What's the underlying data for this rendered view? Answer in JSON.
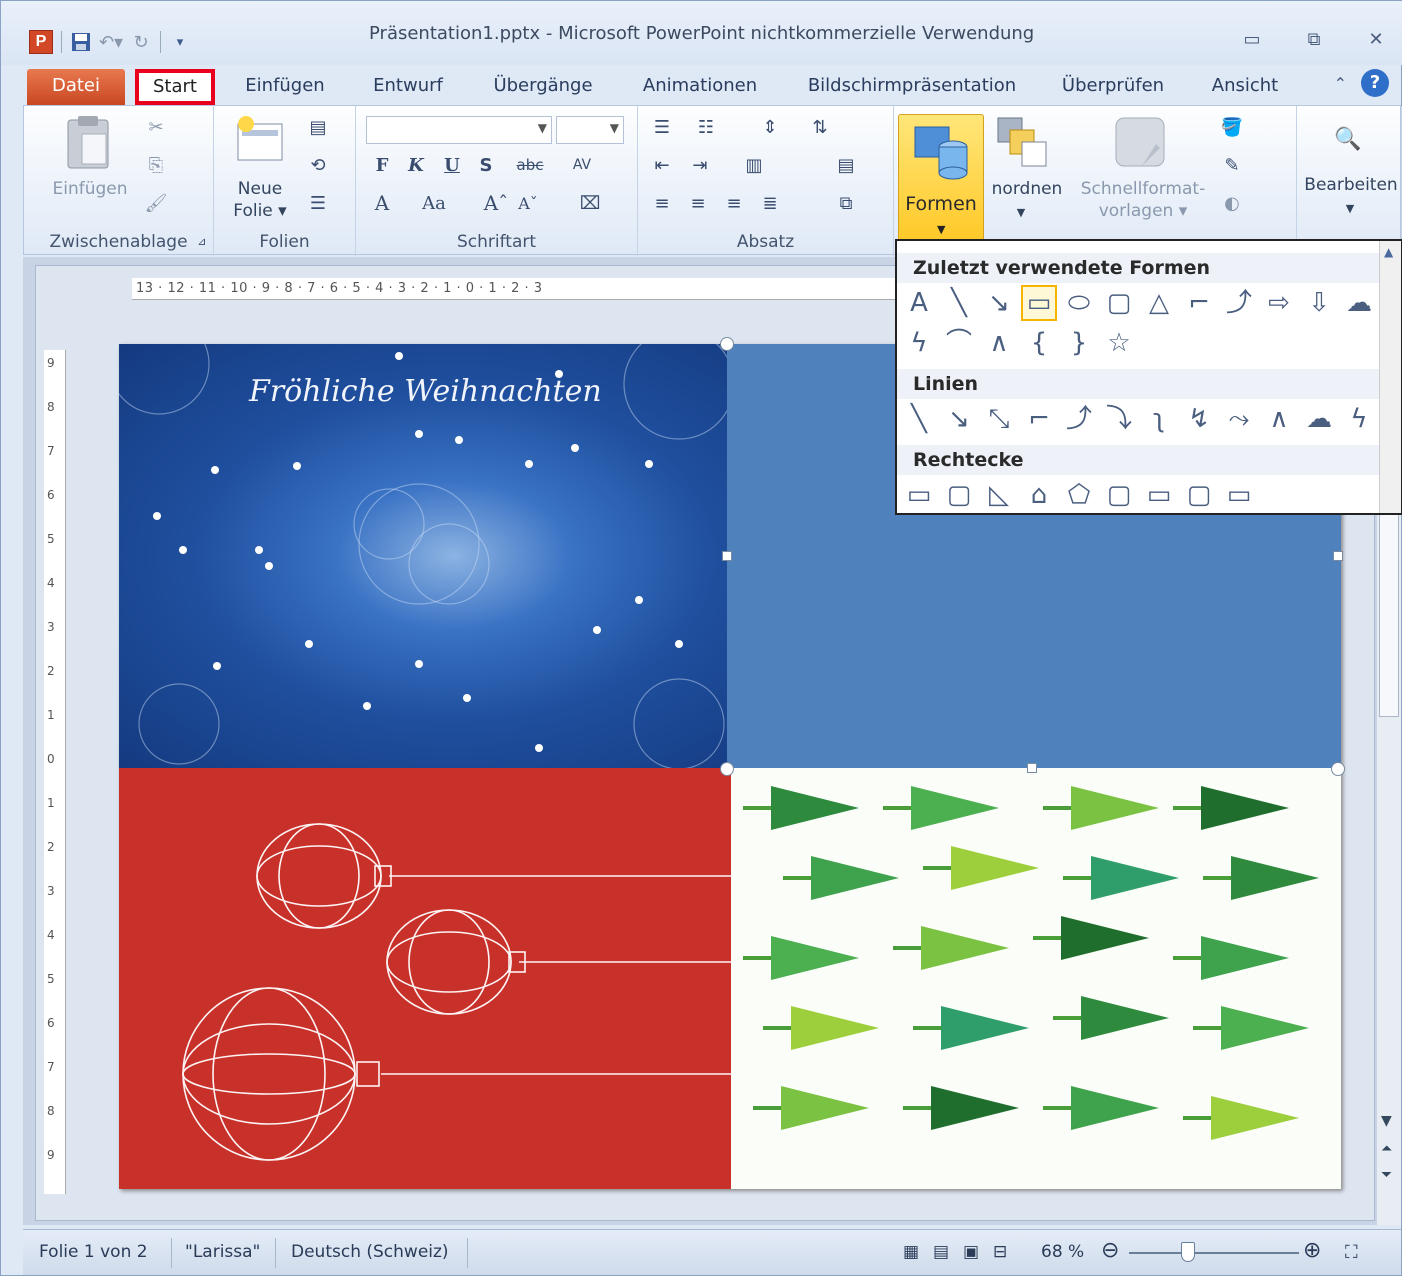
{
  "window": {
    "title": "Präsentation1.pptx - Microsoft PowerPoint nichtkommerzielle Verwendung"
  },
  "tabs": [
    {
      "label": "Datei"
    },
    {
      "label": "Start"
    },
    {
      "label": "Einfügen"
    },
    {
      "label": "Entwurf"
    },
    {
      "label": "Übergänge"
    },
    {
      "label": "Animationen"
    },
    {
      "label": "Bildschirmpräsentation"
    },
    {
      "label": "Überprüfen"
    },
    {
      "label": "Ansicht"
    }
  ],
  "ribbon": {
    "clipboard": {
      "paste_label": "Einfügen",
      "group_label": "Zwischenablage"
    },
    "slides": {
      "new_slide_label": "Neue",
      "new_slide_label2": "Folie",
      "group_label": "Folien"
    },
    "font": {
      "bold": "F",
      "italic": "K",
      "underline": "U",
      "shadow": "S",
      "strike": "abc",
      "spacing": "AV",
      "group_label": "Schriftart"
    },
    "paragraph": {
      "group_label": "Absatz"
    },
    "drawing": {
      "shapes_label": "Formen",
      "arrange_label": "nordnen",
      "quickstyles_label": "Schnellformat-",
      "quickstyles_label2": "vorlagen"
    },
    "editing": {
      "label": "Bearbeiten"
    }
  },
  "ruler": {
    "horizontal": "13 · 12 · 11 · 10 · 9 · 8 · 7 · 6 · 5 · 4 · 3 · 2 · 1 · 0 · 1 · 2 · 3",
    "vertical": [
      "9",
      "8",
      "7",
      "6",
      "5",
      "4",
      "3",
      "2",
      "1",
      "0",
      "1",
      "2",
      "3",
      "4",
      "5",
      "6",
      "7",
      "8",
      "9"
    ]
  },
  "slide": {
    "greeting": "Fröhliche Weihnachten"
  },
  "shapes_panel": {
    "recent_heading": "Zuletzt verwendete Formen",
    "lines_heading": "Linien",
    "rectangles_heading": "Rechtecke",
    "recent_row1": [
      "A",
      "╲",
      "↘",
      "▭",
      "⬭",
      "▢",
      "△",
      "⌐",
      "⤴",
      "⇨",
      "⇩",
      "☁"
    ],
    "recent_row2": [
      "ϟ",
      "⌒",
      "∧",
      "{",
      "}",
      "☆"
    ],
    "lines_row": [
      "╲",
      "↘",
      "⤡",
      "⌐",
      "⤴",
      "⤵",
      "ʅ",
      "↯",
      "⤳",
      "∧",
      "☁",
      "ϟ"
    ],
    "rect_row": [
      "▭",
      "▢",
      "◺",
      "⌂",
      "⬠",
      "▢",
      "▭",
      "▢",
      "▭"
    ]
  },
  "status": {
    "slide_info": "Folie 1 von 2",
    "theme": "\"Larissa\"",
    "language": "Deutsch (Schweiz)",
    "zoom": "68 %"
  },
  "colors": {
    "accent": "#e8001c",
    "formen": "#ffd54a",
    "slide_blue": "#4f81bd",
    "slide_red": "#c8302a"
  }
}
